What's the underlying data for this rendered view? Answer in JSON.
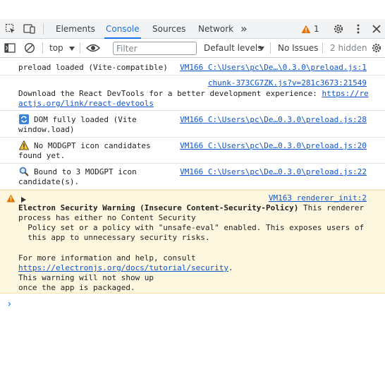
{
  "tabs": {
    "elements": "Elements",
    "console": "Console",
    "sources": "Sources",
    "network": "Network",
    "more": "»",
    "warning_count": "1"
  },
  "toolbar": {
    "context": "top",
    "filter_placeholder": "Filter",
    "levels": "Default levels",
    "issues": "No Issues",
    "hidden": "2 hidden"
  },
  "messages": [
    {
      "text": "preload loaded (Vite-compatible)",
      "source": "VM166 C:\\Users\\pc\\De…\\0.3.0\\preload.js:1"
    },
    {
      "source": "chunk-373CG7ZK.js?v=281c3673:21549",
      "text_before": "Download the React DevTools for a better development experience: ",
      "link_part1": "https://re",
      "link_part2": "actjs.org/link/react-devtools"
    },
    {
      "line1": "DOM fully loaded (Vite",
      "line2": "window.load)",
      "source": "VM166 C:\\Users\\pc\\De…0.3.0\\preload.js:28",
      "icon": "arrows-icon"
    },
    {
      "line1": "No MODGPT icon candidates",
      "line2": "found yet.",
      "source": "VM166 C:\\Users\\pc\\De…0.3.0\\preload.js:20",
      "icon": "warning-icon"
    },
    {
      "line1": "Bound to 3 MODGPT icon",
      "line2": "candidate(s).",
      "source": "VM166 C:\\Users\\pc\\De…0.3.0\\preload.js:22",
      "icon": "magnifier-icon"
    }
  ],
  "warning": {
    "source": "VM163 renderer_init:2",
    "bold": "Electron Security Warning (Insecure Content-Security-Policy)",
    "line1_rest": " This renderer",
    "line2": "process has either no Content Security",
    "line3": "  Policy set or a policy with \"unsafe-eval\" enabled. This exposes users of",
    "line4": "  this app to unnecessary security risks.",
    "line5": "For more information and help, consult",
    "link": "https://electronjs.org/docs/tutorial/security",
    "link_suffix": ".",
    "line7": "This warning will not show up",
    "line8": "once the app is packaged."
  },
  "prompt": "›",
  "colors": {
    "accent": "#1a73e8",
    "warning_bg": "#fef7e0",
    "warning_icon": "#e37400",
    "link": "#1155cc"
  }
}
